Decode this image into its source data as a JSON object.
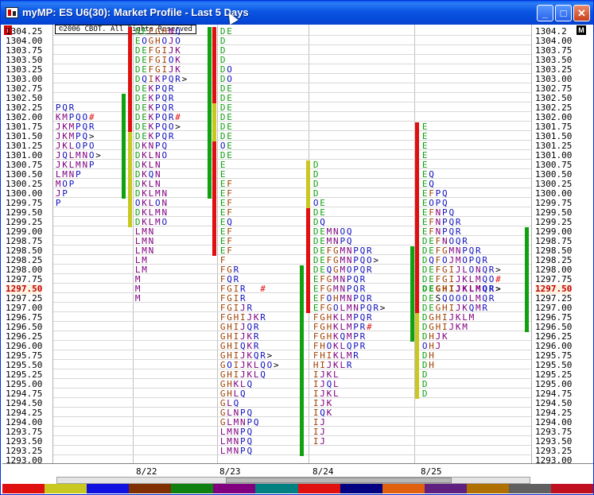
{
  "window": {
    "title": "myMP: ES U6(30): Market Profile - Last 5 Days",
    "colors": {
      "title_bar": "#0a55e2",
      "close": "#c8401c"
    }
  },
  "chart": {
    "copyright": "©2006 CBOT. All Rights Reserved",
    "corner_left": "i",
    "corner_right": "M",
    "current_price": "1297.50",
    "price_labels_left": [
      "1304.25",
      "1304.00",
      "1303.75",
      "1303.50",
      "1303.25",
      "1303.00",
      "1302.75",
      "1302.50",
      "1302.25",
      "1302.00",
      "1301.75",
      "1301.50",
      "1301.25",
      "1301.00",
      "1300.75",
      "1300.50",
      "1300.25",
      "1300.00",
      "1299.75",
      "1299.50",
      "1299.25",
      "1299.00",
      "1298.75",
      "1298.50",
      "1298.25",
      "1298.00",
      "1297.75",
      "1297.50",
      "1297.25",
      "1297.00",
      "1296.75",
      "1296.50",
      "1296.25",
      "1296.00",
      "1295.75",
      "1295.50",
      "1295.25",
      "1295.00",
      "1294.75",
      "1294.50",
      "1294.25",
      "1294.00",
      "1293.75",
      "1293.50",
      "1293.25",
      "1293.00"
    ],
    "price_labels_right": [
      "1304.2",
      "1304.00",
      "1303.75",
      "1303.50",
      "1303.25",
      "1303.00",
      "1302.75",
      "1302.50",
      "1302.25",
      "1302.00",
      "1301.75",
      "1301.50",
      "1301.25",
      "1301.00",
      "1300.75",
      "1300.50",
      "1300.25",
      "1300.00",
      "1299.75",
      "1299.50",
      "1299.25",
      "1299.00",
      "1298.75",
      "1298.50",
      "1298.25",
      "1298.00",
      "1297.75",
      "1297.50",
      "1297.25",
      "1297.00",
      "1296.75",
      "1296.50",
      "1296.25",
      "1296.00",
      "1295.75",
      "1295.50",
      "1295.25",
      "1295.00",
      "1294.75",
      "1294.50",
      "1294.25",
      "1294.00",
      "1293.75",
      "1293.50",
      "1293.25",
      "1293.00"
    ],
    "date_labels": [
      "8/22",
      "8/23",
      "8/24",
      "8/25"
    ],
    "sessions": [
      {
        "name": "prior",
        "rows": [
          "",
          "",
          "",
          "",
          "",
          "",
          "",
          "",
          "PQR",
          "KMPQO#",
          "JKMPQR",
          "JKMPQ>",
          "JKLOPO",
          "JQLMNO>",
          "JKLMNP",
          "LMNP",
          "MOP",
          "JP",
          "P"
        ]
      },
      {
        "name": "8/22",
        "rows": [
          "DEFGHNQ",
          "EOGHOJO",
          "DEFGIJK",
          "DEFGIOK",
          "DEFGIJK",
          "DQIKPQR>",
          "DEKPQR",
          "DEKPQR",
          "DEKPQR",
          "DEKPQR#",
          "DEKPQO>",
          "DEKPQR",
          "DKNPQ",
          "DKLNO",
          "DKLN",
          "DKQN",
          "DKLN",
          "DKLMN",
          "OKLON",
          "DKLMN",
          "DKLMO",
          "LMN",
          "LMN",
          "LMN",
          "LM",
          "LM",
          "M",
          "M",
          "M"
        ]
      },
      {
        "name": "8/23",
        "rows": [
          "DE",
          "D",
          "D",
          "D",
          "DO",
          "DO",
          "DE",
          "DE",
          "DE",
          "DE",
          "DE",
          "DE",
          "OE",
          "DE",
          "E",
          "E",
          "EF",
          "EF",
          "EF",
          "EF",
          "EQ",
          "EF",
          "EF",
          "EF",
          "F",
          "FGR",
          "FQR",
          "FGIR  #",
          "FGIR",
          "FGIJR",
          "FGHIJKR",
          "GHIJQR",
          "GHIJKR",
          "GHIQKR",
          "GHIJKQR>",
          "GOIJKLQO>",
          "GHIJKLQ",
          "GHKLQ",
          "GHLQ",
          "GLQ",
          "GLNPQ",
          "GLMNPQ",
          "LMNPQ",
          "LMNPQ",
          "LMNPQ"
        ]
      },
      {
        "name": "8/24",
        "rows": [
          "",
          "",
          "",
          "",
          "",
          "",
          "",
          "",
          "",
          "",
          "",
          "",
          "",
          "",
          "D",
          "D",
          "D",
          "D",
          "OE",
          "DE",
          "DQ",
          "DEMNOQ",
          "DEMNPQ",
          "DEFGMNPQR",
          "DEFGMNPQO>",
          "DEQGMOPQR",
          "EFGMNPQR",
          "EFGMNPQR",
          "EFOHMNPQR",
          "EFGOLMNPQR>",
          "FGHKLMPQR",
          "FGHKLMPR#",
          "FGHKQMPR",
          "FHOKLQPR",
          "FHIKLMR",
          "HIJKLR",
          "IJKL",
          "IJQL",
          "IJKL",
          "IJK",
          "IQK",
          "IJ",
          "IJ",
          "IJ"
        ]
      },
      {
        "name": "8/25",
        "rows": [
          "",
          "",
          "",
          "",
          "",
          "",
          "",
          "",
          "",
          "",
          "E",
          "E",
          "E",
          "E",
          "E",
          "EQ",
          "EQ",
          "EFPQ",
          "EOPQ",
          "EFNPQ",
          "EFNPQR",
          "EFNPQR",
          "DEFNOQR",
          "DEFGMNPQR",
          "DQFOJMOPQR",
          "DEFGIJLONQR>",
          "DEFGIJKLMQO#",
          "DEGHIJKLMQR>",
          "DESQOOOLMQR",
          "DEGHIJKQMR",
          "DGHIJKLM",
          "DGHIJKM",
          "DHJK",
          "OHJ",
          "DH",
          "DH",
          "D",
          "D",
          "D"
        ]
      }
    ]
  }
}
